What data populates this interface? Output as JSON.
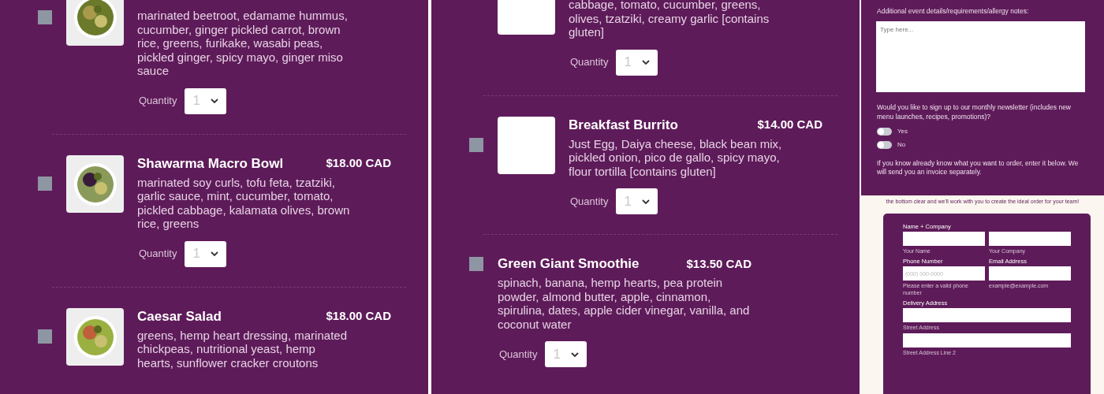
{
  "menu_columns": [
    {
      "items": [
        {
          "description": "marinated beetroot, edamame hummus, cucumber, ginger pickled carrot, brown rice, greens, furikake, wasabi peas, pickled ginger, spicy mayo, ginger miso sauce",
          "checked": false,
          "quantity_label": "Quantity",
          "quantity": "1"
        },
        {
          "name": "Shawarma Macro Bowl",
          "price": "$18.00 CAD",
          "description": "marinated soy curls, tofu feta, tzatziki, garlic sauce, mint, cucumber, tomato, pickled cabbage, kalamata olives, brown rice, greens",
          "checked": false,
          "quantity_label": "Quantity",
          "quantity": "1"
        },
        {
          "name": "Caesar Salad",
          "price": "$18.00 CAD",
          "description": "greens, hemp heart dressing, marinated chickpeas, nutritional yeast, hemp hearts, sunflower cracker croutons",
          "checked": false
        }
      ]
    },
    {
      "items": [
        {
          "description": "cabbage, tomato, cucumber, greens, olives, tzatziki, creamy garlic [contains gluten]",
          "kind": "blank",
          "quantity_label": "Quantity",
          "quantity": "1"
        },
        {
          "name": "Breakfast Burrito",
          "price": "$14.00 CAD",
          "description": "Just Egg, Daiya cheese, black bean mix, pickled onion, pico de gallo, spicy mayo, flour tortilla [contains gluten]",
          "kind": "blank",
          "checked": false,
          "quantity_label": "Quantity",
          "quantity": "1"
        },
        {
          "name": "Green Giant Smoothie",
          "price": "$13.50 CAD",
          "description": "spinach, banana, hemp hearts, pea protein powder, almond butter, apple, cinnamon, spirulina, dates, apple cider vinegar, vanilla, and coconut water",
          "kind": "none",
          "checked": false,
          "quantity_label": "Quantity",
          "quantity": "1"
        }
      ]
    }
  ],
  "event_form": {
    "notes_label": "Additional event details/requirements/allergy notes:",
    "notes_placeholder": "Type here...",
    "newsletter_question": "Would you like to sign up to our monthly newsletter (includes new menu launches, recipes, promotions)?",
    "options": [
      {
        "label": "Yes",
        "on": false
      },
      {
        "label": "No",
        "on": false
      }
    ],
    "order_note": "If you know already know what you want to order, enter it below. We will send you an invoice separately."
  },
  "intro_text": "the bottom clear and we'll work with you to create the ideal order for your team!",
  "order_form": {
    "rows": [
      {
        "kind": "pair",
        "fields": [
          {
            "label": "Name + Company",
            "sublabel": "Your Name"
          },
          {
            "sublabel": "Your Company"
          }
        ]
      },
      {
        "kind": "pair",
        "fields": [
          {
            "label": "Phone Number",
            "placeholder": "(000) 000-0000",
            "sublabel": "Please enter a valid phone number"
          },
          {
            "label": "Email Address",
            "sublabel": "example@example.com"
          }
        ]
      },
      {
        "kind": "single",
        "fields": [
          {
            "label": "Delivery Address",
            "sublabel": "Street Address"
          }
        ]
      },
      {
        "kind": "single",
        "fields": [
          {
            "sublabel": "Street Address Line 2"
          }
        ]
      }
    ]
  }
}
